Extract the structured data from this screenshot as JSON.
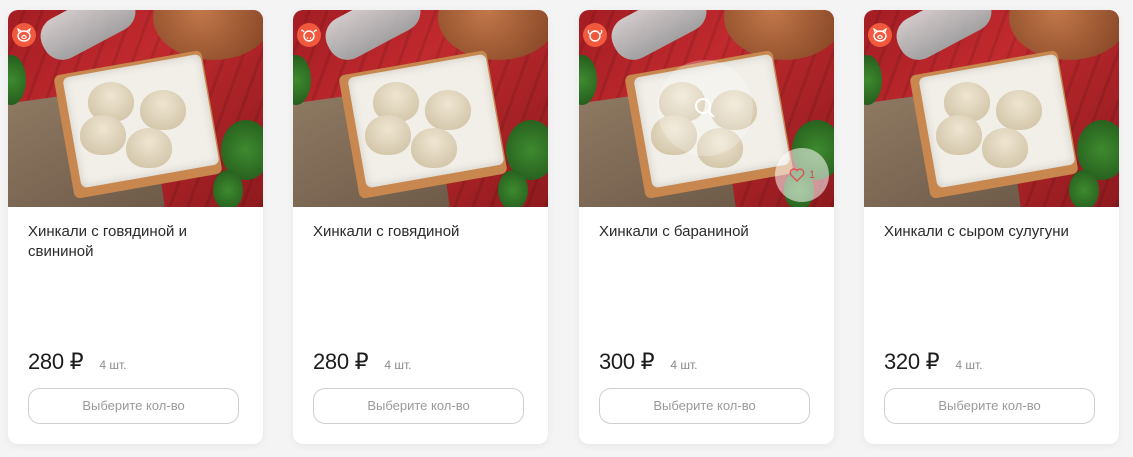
{
  "products": [
    {
      "title": "Хинкали с говядиной и свининой",
      "price": "280 ₽",
      "quantity": "4 шт.",
      "select_label": "Выберите кол-во",
      "badge_icon": "pig-icon"
    },
    {
      "title": "Хинкали с говядиной",
      "price": "280 ₽",
      "quantity": "4 шт.",
      "select_label": "Выберите кол-во",
      "badge_icon": "cow-icon"
    },
    {
      "title": "Хинкали с бараниной",
      "price": "300 ₽",
      "quantity": "4 шт.",
      "select_label": "Выберите кол-во",
      "badge_icon": "sheep-icon",
      "favorites_count": "1"
    },
    {
      "title": "Хинкали с сыром сулугуни",
      "price": "320 ₽",
      "quantity": "4 шт.",
      "select_label": "Выберите кол-во",
      "badge_icon": "pig-icon"
    }
  ],
  "colors": {
    "badge": "#f0593e",
    "card_bg": "#ffffff",
    "page_bg": "#f4f4f5"
  }
}
